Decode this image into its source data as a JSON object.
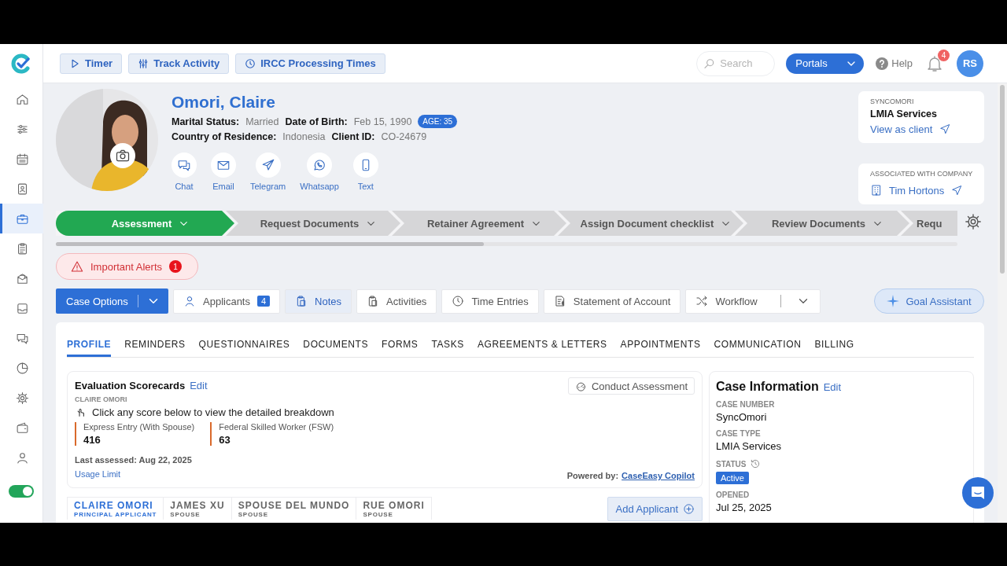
{
  "toolbar": [
    {
      "label": "Timer"
    },
    {
      "label": "Track Activity"
    },
    {
      "label": "IRCC Processing Times"
    }
  ],
  "search": {
    "placeholder": "Search"
  },
  "portals": {
    "label": "Portals"
  },
  "help": {
    "label": "Help"
  },
  "notifications": {
    "count": "4"
  },
  "user": {
    "initials": "RS"
  },
  "sidebar": {
    "items": [
      {
        "selected": false
      },
      {
        "selected": false
      },
      {
        "selected": false
      },
      {
        "selected": false
      },
      {
        "selected": true
      },
      {
        "selected": false
      },
      {
        "selected": false
      },
      {
        "selected": false
      },
      {
        "selected": false
      },
      {
        "selected": false
      },
      {
        "selected": false
      },
      {
        "selected": false
      },
      {
        "selected": false
      }
    ],
    "toggle": {
      "on": true
    }
  },
  "client": {
    "name": "Omori, Claire",
    "rows": [
      [
        {
          "label": "Marital Status:",
          "value": "Married"
        },
        {
          "label": "Date of Birth:",
          "value": "Feb 15, 1990"
        }
      ],
      [
        {
          "label": "Country of Residence:",
          "value": "Indonesia"
        },
        {
          "label": "Client ID:",
          "value": "CO-24679"
        }
      ]
    ],
    "age": "AGE: 35",
    "contacts": [
      "Chat",
      "Email",
      "Telegram",
      "Whatsapp",
      "Text"
    ]
  },
  "case_card": {
    "caption": "SYNCOMORI",
    "title": "LMIA Services",
    "link": "View as client"
  },
  "company_card": {
    "caption": "ASSOCIATED WITH COMPANY",
    "link": "Tim Hortons"
  },
  "stages": [
    {
      "label": "Assessment",
      "selected": true
    },
    {
      "label": "Request Documents",
      "selected": false
    },
    {
      "label": "Retainer Agreement",
      "selected": false
    },
    {
      "label": "Assign Document checklist",
      "selected": false
    },
    {
      "label": "Review Documents",
      "selected": false
    },
    {
      "label": "Requ",
      "selected": false
    }
  ],
  "alerts": {
    "label": "Important Alerts",
    "count": "1"
  },
  "case_options": {
    "label": "Case Options"
  },
  "actions": [
    {
      "label": "Applicants",
      "count": "4",
      "highlighted": false
    },
    {
      "label": "Notes",
      "highlighted": true
    },
    {
      "label": "Activities",
      "highlighted": false
    },
    {
      "label": "Time Entries",
      "highlighted": false
    },
    {
      "label": "Statement of Account",
      "highlighted": false
    },
    {
      "label": "Workflow",
      "highlighted": false
    }
  ],
  "goal_assistant": {
    "label": "Goal Assistant"
  },
  "tabs": [
    {
      "label": "PROFILE",
      "selected": true
    },
    {
      "label": "REMINDERS",
      "selected": false
    },
    {
      "label": "QUESTIONNAIRES",
      "selected": false
    },
    {
      "label": "DOCUMENTS",
      "selected": false
    },
    {
      "label": "FORMS",
      "selected": false
    },
    {
      "label": "TASKS",
      "selected": false
    },
    {
      "label": "AGREEMENTS & LETTERS",
      "selected": false
    },
    {
      "label": "APPOINTMENTS",
      "selected": false
    },
    {
      "label": "COMMUNICATION",
      "selected": false
    },
    {
      "label": "BILLING",
      "selected": false
    }
  ],
  "scorecard": {
    "title": "Evaluation Scorecards",
    "edit": "Edit",
    "person": "CLAIRE OMORI",
    "hint": "Click any score below to view the detailed breakdown",
    "scores": [
      {
        "label": "Express Entry (With Spouse)",
        "value": "416"
      },
      {
        "label": "Federal Skilled Worker (FSW)",
        "value": "63"
      }
    ],
    "last_assessed": "Last assessed: Aug 22, 2025",
    "usage": "Usage Limit",
    "conduct": "Conduct Assessment",
    "powered_label": "Powered by:",
    "powered_link": "CaseEasy Copilot"
  },
  "applicants": [
    {
      "name": "CLAIRE OMORI",
      "role": "PRINCIPAL APPLICANT",
      "selected": true
    },
    {
      "name": "JAMES XU",
      "role": "SPOUSE",
      "selected": false
    },
    {
      "name": "SPOUSE DEL MUNDO",
      "role": "SPOUSE",
      "selected": false
    },
    {
      "name": "RUE OMORI",
      "role": "SPOUSE",
      "selected": false
    }
  ],
  "add_applicant": {
    "label": "Add Applicant"
  },
  "case_info": {
    "title": "Case Information",
    "edit": "Edit",
    "fields": [
      {
        "label": "CASE NUMBER",
        "value": "SyncOmori",
        "kind": "text"
      },
      {
        "label": "CASE TYPE",
        "value": "LMIA Services",
        "kind": "text"
      },
      {
        "label": "STATUS",
        "value": "Active",
        "kind": "badge"
      },
      {
        "label": "OPENED",
        "value": "Jul 25, 2025",
        "kind": "text"
      }
    ]
  }
}
